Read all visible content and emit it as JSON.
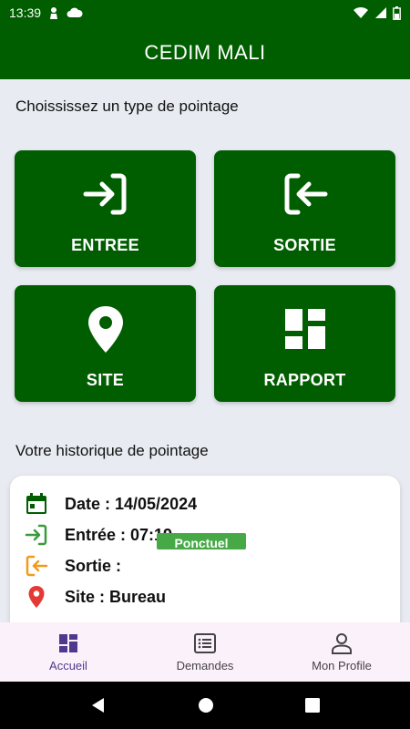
{
  "status_bar": {
    "time": "13:39",
    "icons_left": [
      "person-icon",
      "cloud-icon"
    ],
    "icons_right": [
      "wifi-icon",
      "signal-icon",
      "battery-icon"
    ]
  },
  "app_bar": {
    "title": "CEDIM MALI"
  },
  "main": {
    "choose_title": "Choississez un type de pointage",
    "tiles": [
      {
        "label": "ENTREE",
        "icon": "login-icon"
      },
      {
        "label": "SORTIE",
        "icon": "logout-icon"
      },
      {
        "label": "SITE",
        "icon": "location-pin-icon"
      },
      {
        "label": "RAPPORT",
        "icon": "dashboard-icon"
      }
    ],
    "history_title": "Votre historique de pointage",
    "history": {
      "date": "Date : 14/05/2024",
      "entry": "Entrée : 07:19",
      "exit": "Sortie :",
      "site": "Site : Bureau",
      "badge": "Ponctuel"
    }
  },
  "bottom_nav": {
    "items": [
      {
        "label": "Accueil",
        "icon": "dashboard-icon",
        "active": true
      },
      {
        "label": "Demandes",
        "icon": "list-icon",
        "active": false
      },
      {
        "label": "Mon Profile",
        "icon": "person-icon",
        "active": false
      }
    ]
  },
  "colors": {
    "primary": "#005e00",
    "background": "#e8ebf1",
    "entry_green": "#3c9a3c",
    "exit_orange": "#f29a1a",
    "site_red": "#e53935",
    "nav_active": "#4d3a8c",
    "badge_green": "#46a946"
  }
}
